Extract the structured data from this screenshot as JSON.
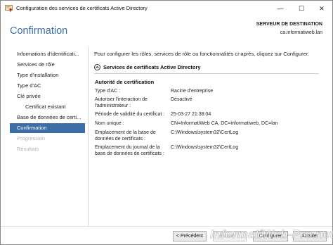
{
  "window": {
    "title": "Configuration des services de certificats Active Directory",
    "minimize_glyph": "—",
    "maximize_glyph": "☐",
    "close_glyph": "✕"
  },
  "header": {
    "page_title": "Confirmation",
    "destination_label": "SERVEUR DE DESTINATION",
    "destination_server": "ca.informatiweb.lan"
  },
  "nav": {
    "items": [
      {
        "label": "Informations d'identificati...",
        "state": "normal"
      },
      {
        "label": "Services de rôle",
        "state": "normal"
      },
      {
        "label": "Type d'installation",
        "state": "normal"
      },
      {
        "label": "Type d'AC",
        "state": "normal"
      },
      {
        "label": "Clé privée",
        "state": "normal"
      },
      {
        "label": "Certificat existant",
        "state": "sub"
      },
      {
        "label": "Base de données de certi...",
        "state": "normal"
      },
      {
        "label": "Confirmation",
        "state": "active"
      },
      {
        "label": "Progression",
        "state": "disabled"
      },
      {
        "label": "Résultats",
        "state": "disabled"
      }
    ]
  },
  "content": {
    "intro": "Pour configurer les rôles, services de rôle ou fonctionnalités ci-après, cliquez sur Configurer.",
    "section_title": "Services de certificats Active Directory",
    "group_title": "Autorité de certification",
    "rows": [
      {
        "label": "Type d'AC :",
        "value": "Racine d'entreprise"
      },
      {
        "label": "Autoriser l'interaction de l'administrateur :",
        "value": "Désactivé"
      },
      {
        "label": "Période de validité du certificat :",
        "value": "25-03-27 21:38:04"
      },
      {
        "label": "Nom unique :",
        "value": "CN=InformatiWeb CA, DC=informatiweb, DC=lan"
      },
      {
        "label": "Emplacement de la base de données de certificats :",
        "value": "C:\\Windows\\system32\\CertLog"
      },
      {
        "label": "Emplacement du journal de la base de données de certificats :",
        "value": "C:\\Windows\\system32\\CertLog"
      }
    ]
  },
  "footer": {
    "previous_label": "< Précédent",
    "next_label": "Suivant >",
    "configure_label": "Configurer",
    "cancel_label": "Annuler"
  },
  "watermark": "InformatiWeb-Pro.net",
  "colors": {
    "accent": "#3a6ea5",
    "nav_active_bg": "#3a6ea5",
    "disabled_text": "#b3b3b3"
  }
}
